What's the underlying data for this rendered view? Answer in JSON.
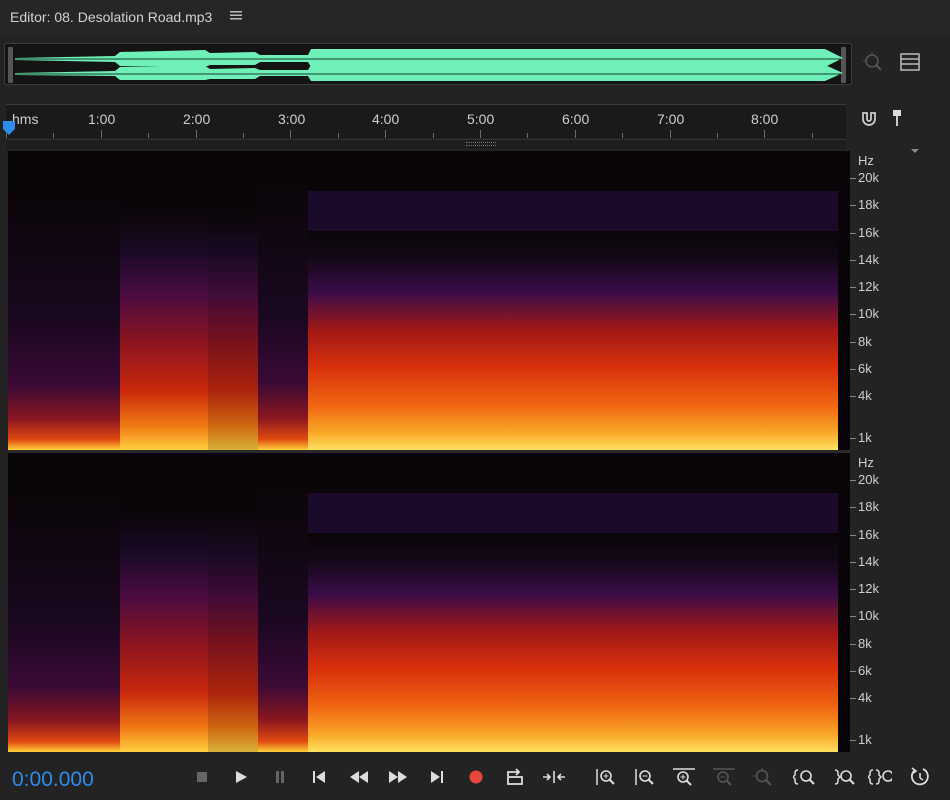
{
  "editor": {
    "title": "Editor: 08. Desolation Road.mp3"
  },
  "ruler": {
    "unit_label": "hms",
    "labels": [
      "1:00",
      "2:00",
      "3:00",
      "4:00",
      "5:00",
      "6:00",
      "7:00",
      "8:00"
    ]
  },
  "channels": [
    {
      "hz_unit": "Hz",
      "hz_labels": [
        "20k",
        "18k",
        "16k",
        "14k",
        "12k",
        "10k",
        "8k",
        "6k",
        "4k",
        "1k"
      ]
    },
    {
      "hz_unit": "Hz",
      "hz_labels": [
        "20k",
        "18k",
        "16k",
        "14k",
        "12k",
        "10k",
        "8k",
        "6k",
        "4k",
        "1k"
      ]
    }
  ],
  "transport": {
    "current_time": "0:00.000"
  },
  "icons": {
    "menu": "hamburger-icon",
    "overview_zoom": "zoom-target-icon",
    "list": "list-icon",
    "snap": "magnet-icon",
    "marker": "marker-pin-icon",
    "stop": "stop-icon",
    "play": "play-icon",
    "pause": "pause-icon",
    "prev": "skip-back-icon",
    "rewind": "rewind-icon",
    "ffwd": "fast-forward-icon",
    "next": "skip-forward-icon",
    "record": "record-icon",
    "loop": "loop-playback-icon",
    "skip_selection": "skip-selection-icon",
    "zoom_in_amp": "zoom-in-amplitude-icon",
    "zoom_out_amp": "zoom-out-amplitude-icon",
    "zoom_in_time": "zoom-in-time-icon",
    "zoom_out_full": "zoom-out-full-icon",
    "zoom_selection": "zoom-selection-icon",
    "zoom_in_left": "zoom-in-left-icon",
    "zoom_in_right": "zoom-in-right-icon",
    "zoom_out_both": "zoom-out-both-icon",
    "reset_zoom": "reset-zoom-icon"
  },
  "colors": {
    "accent": "#2d8ceb",
    "waveform": "#6ff0b8",
    "record": "#e8453c"
  }
}
